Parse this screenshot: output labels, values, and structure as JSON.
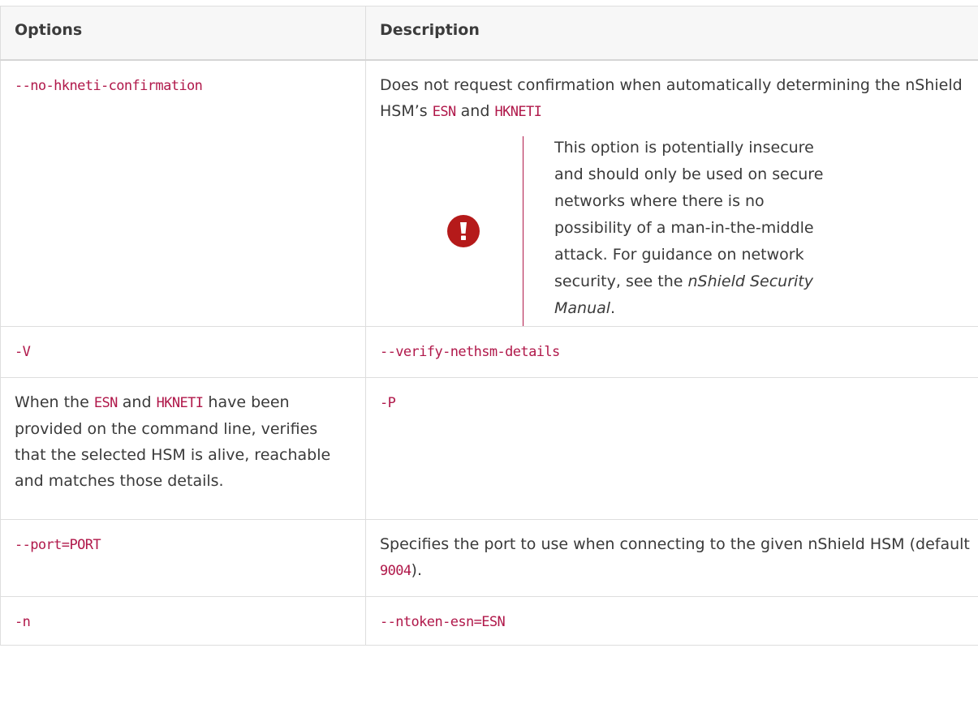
{
  "table": {
    "headers": [
      "Options",
      "Description"
    ],
    "row1": {
      "option": "--no-hkneti-confirmation",
      "desc_prefix": "Does not request confirmation when automatically determining the nShield HSM’s ",
      "esn": "ESN",
      "and": " and ",
      "hkneti": "HKNETI",
      "warning": {
        "icon": "exclamation-icon",
        "text_main": "This option is potentially insecure and should only be used on secure networks where there is no possibility of a man-in-the-middle attack. For guidance on network security, see the ",
        "manual": "nShield Security Manual",
        "end": "."
      }
    },
    "row2": {
      "option": "-V",
      "desc": "--verify-nethsm-details"
    },
    "row3": {
      "prefix": "When the ",
      "esn": "ESN",
      "and": " and ",
      "hkneti": "HKNETI",
      "suffix": " have been provided on the command line, verifies that the selected HSM is alive, reachable and matches those details.",
      "desc": "-P"
    },
    "row4": {
      "option": "--port=PORT",
      "desc_prefix": "Specifies the port to use when connecting to the given nShield HSM (default ",
      "port": "9004",
      "desc_suffix": ")."
    },
    "row5": {
      "option": "-n",
      "desc": "--ntoken-esn=ESN"
    }
  },
  "colors": {
    "code": "#b0184a",
    "warning_icon": "#b51a1a",
    "header_bg": "#f7f7f7"
  }
}
